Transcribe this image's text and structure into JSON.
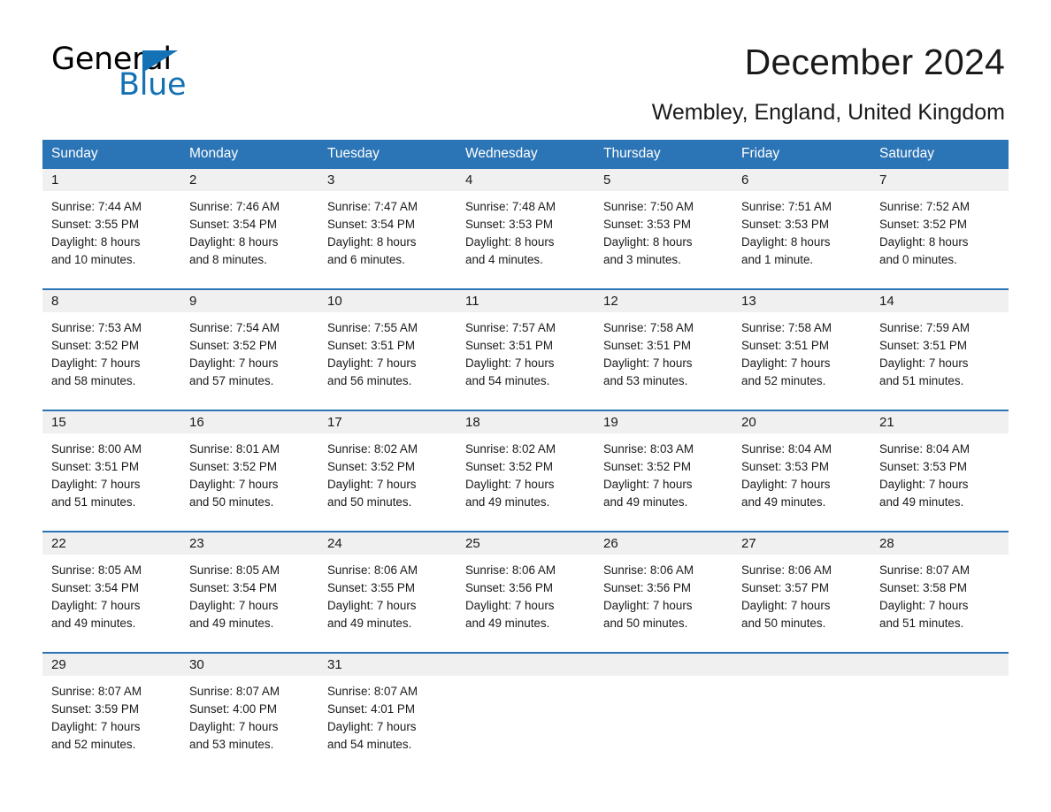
{
  "brand": {
    "name_part1": "General",
    "name_part2": "Blue",
    "accent_color": "#1272b5"
  },
  "header": {
    "title": "December 2024",
    "subtitle": "Wembley, England, United Kingdom"
  },
  "calendar": {
    "header_bg": "#2b74b5",
    "daynum_bg": "#f0f0f0",
    "weekdays": [
      "Sunday",
      "Monday",
      "Tuesday",
      "Wednesday",
      "Thursday",
      "Friday",
      "Saturday"
    ],
    "weeks": [
      [
        {
          "day": "1",
          "l1": "Sunrise: 7:44 AM",
          "l2": "Sunset: 3:55 PM",
          "l3": "Daylight: 8 hours",
          "l4": "and 10 minutes."
        },
        {
          "day": "2",
          "l1": "Sunrise: 7:46 AM",
          "l2": "Sunset: 3:54 PM",
          "l3": "Daylight: 8 hours",
          "l4": "and 8 minutes."
        },
        {
          "day": "3",
          "l1": "Sunrise: 7:47 AM",
          "l2": "Sunset: 3:54 PM",
          "l3": "Daylight: 8 hours",
          "l4": "and 6 minutes."
        },
        {
          "day": "4",
          "l1": "Sunrise: 7:48 AM",
          "l2": "Sunset: 3:53 PM",
          "l3": "Daylight: 8 hours",
          "l4": "and 4 minutes."
        },
        {
          "day": "5",
          "l1": "Sunrise: 7:50 AM",
          "l2": "Sunset: 3:53 PM",
          "l3": "Daylight: 8 hours",
          "l4": "and 3 minutes."
        },
        {
          "day": "6",
          "l1": "Sunrise: 7:51 AM",
          "l2": "Sunset: 3:53 PM",
          "l3": "Daylight: 8 hours",
          "l4": "and 1 minute."
        },
        {
          "day": "7",
          "l1": "Sunrise: 7:52 AM",
          "l2": "Sunset: 3:52 PM",
          "l3": "Daylight: 8 hours",
          "l4": "and 0 minutes."
        }
      ],
      [
        {
          "day": "8",
          "l1": "Sunrise: 7:53 AM",
          "l2": "Sunset: 3:52 PM",
          "l3": "Daylight: 7 hours",
          "l4": "and 58 minutes."
        },
        {
          "day": "9",
          "l1": "Sunrise: 7:54 AM",
          "l2": "Sunset: 3:52 PM",
          "l3": "Daylight: 7 hours",
          "l4": "and 57 minutes."
        },
        {
          "day": "10",
          "l1": "Sunrise: 7:55 AM",
          "l2": "Sunset: 3:51 PM",
          "l3": "Daylight: 7 hours",
          "l4": "and 56 minutes."
        },
        {
          "day": "11",
          "l1": "Sunrise: 7:57 AM",
          "l2": "Sunset: 3:51 PM",
          "l3": "Daylight: 7 hours",
          "l4": "and 54 minutes."
        },
        {
          "day": "12",
          "l1": "Sunrise: 7:58 AM",
          "l2": "Sunset: 3:51 PM",
          "l3": "Daylight: 7 hours",
          "l4": "and 53 minutes."
        },
        {
          "day": "13",
          "l1": "Sunrise: 7:58 AM",
          "l2": "Sunset: 3:51 PM",
          "l3": "Daylight: 7 hours",
          "l4": "and 52 minutes."
        },
        {
          "day": "14",
          "l1": "Sunrise: 7:59 AM",
          "l2": "Sunset: 3:51 PM",
          "l3": "Daylight: 7 hours",
          "l4": "and 51 minutes."
        }
      ],
      [
        {
          "day": "15",
          "l1": "Sunrise: 8:00 AM",
          "l2": "Sunset: 3:51 PM",
          "l3": "Daylight: 7 hours",
          "l4": "and 51 minutes."
        },
        {
          "day": "16",
          "l1": "Sunrise: 8:01 AM",
          "l2": "Sunset: 3:52 PM",
          "l3": "Daylight: 7 hours",
          "l4": "and 50 minutes."
        },
        {
          "day": "17",
          "l1": "Sunrise: 8:02 AM",
          "l2": "Sunset: 3:52 PM",
          "l3": "Daylight: 7 hours",
          "l4": "and 50 minutes."
        },
        {
          "day": "18",
          "l1": "Sunrise: 8:02 AM",
          "l2": "Sunset: 3:52 PM",
          "l3": "Daylight: 7 hours",
          "l4": "and 49 minutes."
        },
        {
          "day": "19",
          "l1": "Sunrise: 8:03 AM",
          "l2": "Sunset: 3:52 PM",
          "l3": "Daylight: 7 hours",
          "l4": "and 49 minutes."
        },
        {
          "day": "20",
          "l1": "Sunrise: 8:04 AM",
          "l2": "Sunset: 3:53 PM",
          "l3": "Daylight: 7 hours",
          "l4": "and 49 minutes."
        },
        {
          "day": "21",
          "l1": "Sunrise: 8:04 AM",
          "l2": "Sunset: 3:53 PM",
          "l3": "Daylight: 7 hours",
          "l4": "and 49 minutes."
        }
      ],
      [
        {
          "day": "22",
          "l1": "Sunrise: 8:05 AM",
          "l2": "Sunset: 3:54 PM",
          "l3": "Daylight: 7 hours",
          "l4": "and 49 minutes."
        },
        {
          "day": "23",
          "l1": "Sunrise: 8:05 AM",
          "l2": "Sunset: 3:54 PM",
          "l3": "Daylight: 7 hours",
          "l4": "and 49 minutes."
        },
        {
          "day": "24",
          "l1": "Sunrise: 8:06 AM",
          "l2": "Sunset: 3:55 PM",
          "l3": "Daylight: 7 hours",
          "l4": "and 49 minutes."
        },
        {
          "day": "25",
          "l1": "Sunrise: 8:06 AM",
          "l2": "Sunset: 3:56 PM",
          "l3": "Daylight: 7 hours",
          "l4": "and 49 minutes."
        },
        {
          "day": "26",
          "l1": "Sunrise: 8:06 AM",
          "l2": "Sunset: 3:56 PM",
          "l3": "Daylight: 7 hours",
          "l4": "and 50 minutes."
        },
        {
          "day": "27",
          "l1": "Sunrise: 8:06 AM",
          "l2": "Sunset: 3:57 PM",
          "l3": "Daylight: 7 hours",
          "l4": "and 50 minutes."
        },
        {
          "day": "28",
          "l1": "Sunrise: 8:07 AM",
          "l2": "Sunset: 3:58 PM",
          "l3": "Daylight: 7 hours",
          "l4": "and 51 minutes."
        }
      ],
      [
        {
          "day": "29",
          "l1": "Sunrise: 8:07 AM",
          "l2": "Sunset: 3:59 PM",
          "l3": "Daylight: 7 hours",
          "l4": "and 52 minutes."
        },
        {
          "day": "30",
          "l1": "Sunrise: 8:07 AM",
          "l2": "Sunset: 4:00 PM",
          "l3": "Daylight: 7 hours",
          "l4": "and 53 minutes."
        },
        {
          "day": "31",
          "l1": "Sunrise: 8:07 AM",
          "l2": "Sunset: 4:01 PM",
          "l3": "Daylight: 7 hours",
          "l4": "and 54 minutes."
        },
        {
          "day": "",
          "l1": "",
          "l2": "",
          "l3": "",
          "l4": ""
        },
        {
          "day": "",
          "l1": "",
          "l2": "",
          "l3": "",
          "l4": ""
        },
        {
          "day": "",
          "l1": "",
          "l2": "",
          "l3": "",
          "l4": ""
        },
        {
          "day": "",
          "l1": "",
          "l2": "",
          "l3": "",
          "l4": ""
        }
      ]
    ]
  }
}
